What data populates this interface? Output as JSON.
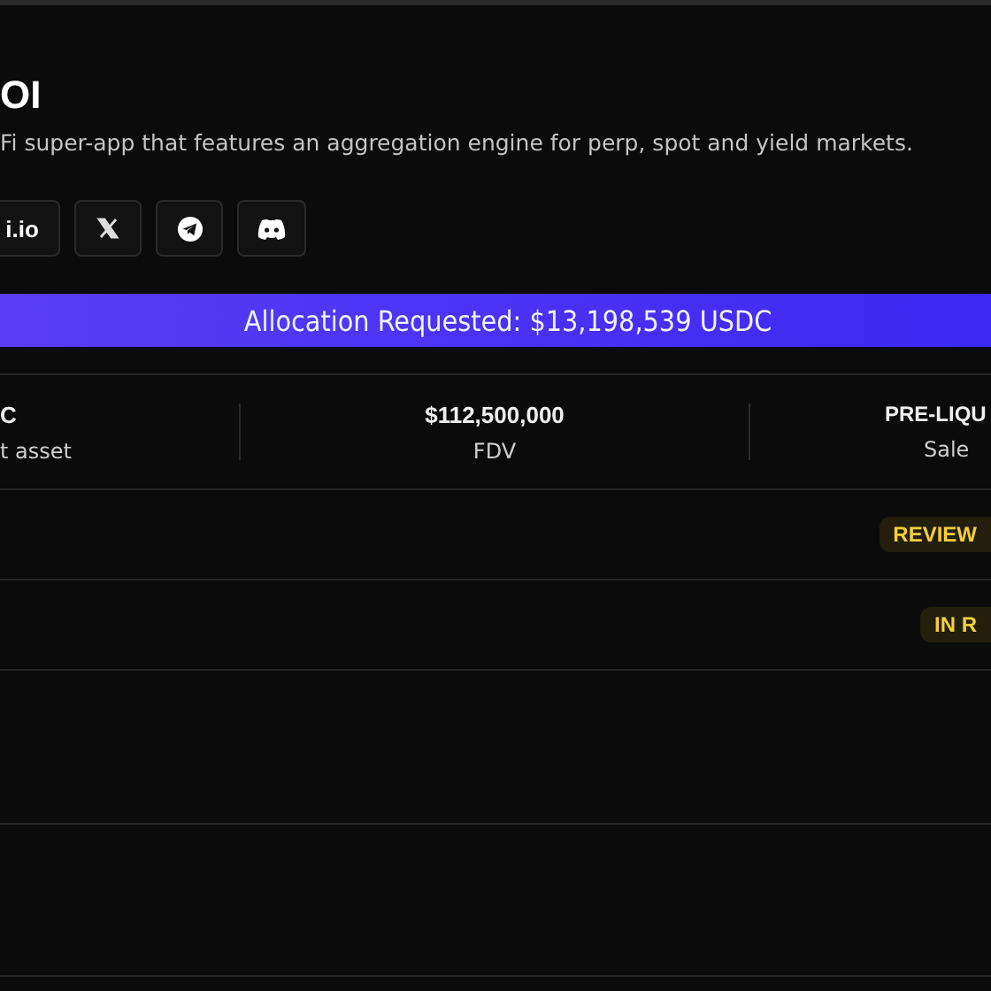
{
  "project": {
    "title": "OI",
    "description": "Fi super-app that features an aggregation engine for perp, spot and yield markets."
  },
  "links": [
    {
      "kind": "text",
      "label": "i.io"
    },
    {
      "kind": "x"
    },
    {
      "kind": "telegram"
    },
    {
      "kind": "discord"
    }
  ],
  "banner": {
    "text": "Allocation Requested: $13,198,539 USDC"
  },
  "stats": [
    {
      "value": "C",
      "label": "t asset"
    },
    {
      "value": "$112,500,000",
      "label": "FDV"
    },
    {
      "value": "PRE-LIQU",
      "label": "Sale"
    }
  ],
  "rows": [
    {
      "status": "REVIEW"
    },
    {
      "status": "IN R"
    },
    {},
    {}
  ]
}
